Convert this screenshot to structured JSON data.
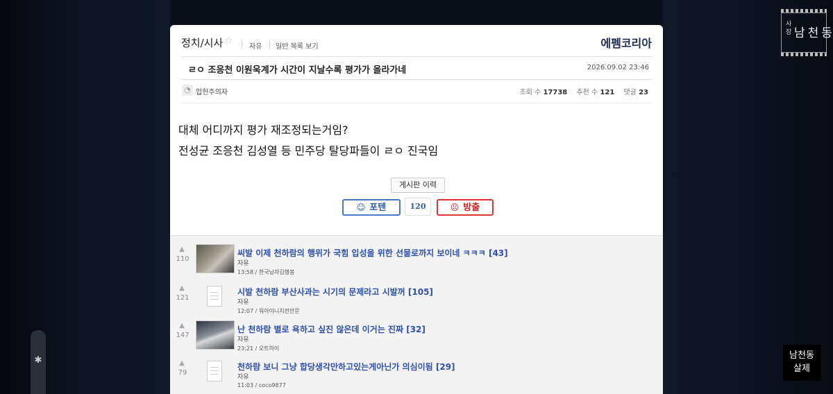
{
  "board": {
    "title": "정치/시사",
    "star_icon": "star-icon",
    "link1": "자유",
    "link2": "일반 목록 보기",
    "logo": "에펨코리아"
  },
  "post": {
    "title": "ㄹㅇ 조응천 이원욱계가 시간이 지날수록 평가가 올라가네",
    "date": "2026.09.02 23:46",
    "author": "입헌주의자",
    "views_label": "조회 수",
    "views": "17738",
    "rec_label": "추천 수",
    "rec": "121",
    "comments_label": "댓글",
    "comments": "23",
    "body": [
      "대체 어디까지 평가 재조정되는거임?",
      "전성균 조응천 김성열 등 민주당 탈당파들이 ㄹㅇ 진국임"
    ],
    "history_button": "게시판 이력",
    "vote_up": "포텐",
    "vote_count": "120",
    "vote_down": "방출"
  },
  "related": [
    {
      "likes": "110",
      "title": "씨발 이제 천하람의 행위가 국힘 입성을 위한 선물로까지 보이네 ㅋㅋㅋ",
      "count": "[43]",
      "category": "자유",
      "meta": "13:58 / 한국남자김행봉",
      "thumb": "photo"
    },
    {
      "likes": "121",
      "title": "시발 천하람 부산사과는 시기의 문제라고 시발꺼",
      "count": "[105]",
      "category": "자유",
      "meta": "12:07 / 워아이니치전안문",
      "thumb": "doc"
    },
    {
      "likes": "147",
      "title": "난 천하람 별로 욕하고 싶진 않은데 이거는 진짜",
      "count": "[32]",
      "category": "자유",
      "meta": "23:21 / 오트하이",
      "thumb": "photo"
    },
    {
      "likes": "79",
      "title": "천하람 보니 그냥 합당생각만하고있는게아닌가 의심이됨",
      "count": "[29]",
      "category": "자유",
      "meta": "11:03 / coco9877",
      "thumb": "doc"
    }
  ],
  "overlay": {
    "badge_small": "사장",
    "badge_main": "남천동",
    "corner_line1": "남천동",
    "corner_line2": "살제"
  }
}
